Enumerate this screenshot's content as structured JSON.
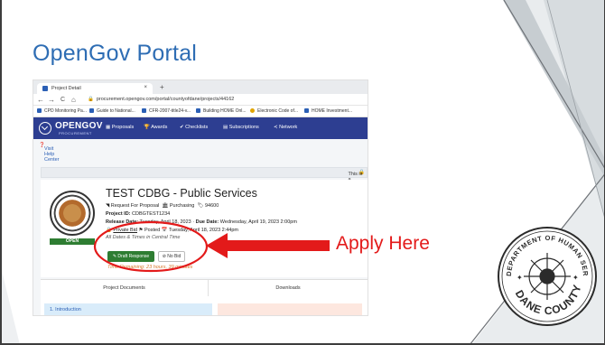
{
  "slide": {
    "title": "OpenGov Portal",
    "annotation": "Apply Here",
    "accent_color": "#e31a1a",
    "title_color": "#2e6db4"
  },
  "browser": {
    "tab_title": "Project Detail",
    "tab_close": "×",
    "new_tab": "+",
    "back": "←",
    "forward": "→",
    "reload": "C",
    "home": "⌂",
    "url": "procurement.opengov.com/portal/countyofdane/projects/44162",
    "bookmarks": [
      "CPD Monitoring Pa...",
      "Guide to National...",
      "CFR-2007-title24-v...",
      "Building HOME Onl...",
      "Electronic Code of...",
      "HOME Investment..."
    ]
  },
  "app": {
    "brand": "OPENGOV",
    "brand_sub": "PROCUREMENT",
    "nav": [
      "Proposals",
      "Awards",
      "Checklists",
      "Subscriptions",
      "Network"
    ],
    "help_link": "Visit Help Center",
    "private_note": "This is a private bid a",
    "project": {
      "title": "TEST CDBG - Public Services",
      "type_line": "Request For Proposal",
      "dept": "Purchasing",
      "tag": "94600",
      "project_id_label": "Project ID:",
      "project_id": "CDBGTEST1234",
      "release_label": "Release Date:",
      "release_date": "Tuesday, April 18, 2023",
      "due_label": "Due Date:",
      "due_date": "Wednesday, April 19, 2023 2:00pm",
      "private_bid": "Private Bid",
      "posted_label": "Posted",
      "posted_date": "Tuesday, April 18, 2023 2:44pm",
      "tz_note": "All Dates & Times in Central Time",
      "status": "OPEN"
    },
    "draft_button": "Draft Response",
    "nobid_button": "No Bid",
    "time_remaining": "Time Remaining: 23 hours, 39 minutes",
    "tabs": [
      "Project Documents",
      "Downloads"
    ],
    "intro_item": "1. Introduction"
  },
  "seal": {
    "text_top": "DEPARTMENT OF HUMAN SERVICES",
    "text_bottom": "DANE COUNTY"
  }
}
